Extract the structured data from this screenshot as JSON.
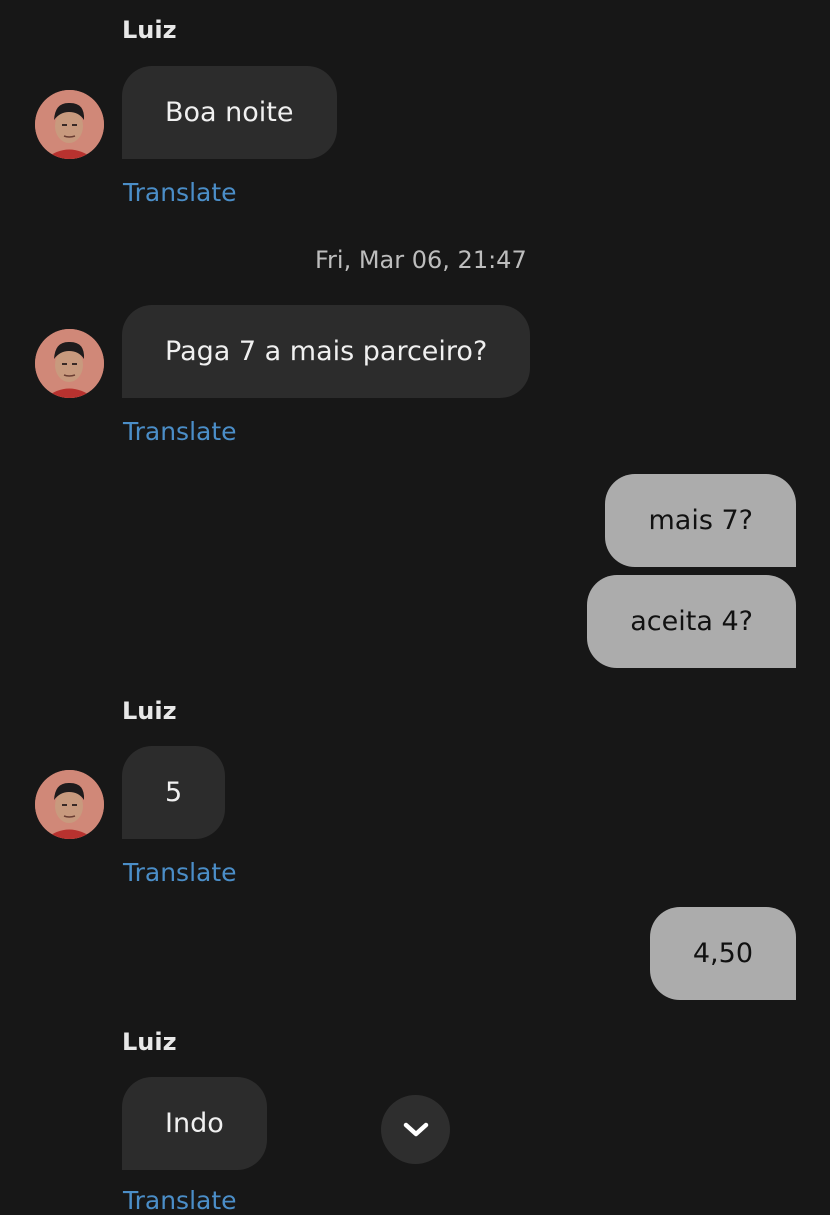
{
  "contact": {
    "name": "Luiz"
  },
  "messages": [
    {
      "direction": "in",
      "text": "Boa noite",
      "translate": "Translate"
    },
    {
      "direction": "in",
      "text": "Paga 7 a mais parceiro?",
      "translate": "Translate"
    },
    {
      "direction": "out",
      "text": "mais 7?"
    },
    {
      "direction": "out",
      "text": "aceita 4?"
    },
    {
      "direction": "in",
      "text": "5",
      "translate": "Translate"
    },
    {
      "direction": "out",
      "text": "4,50"
    },
    {
      "direction": "in",
      "text": "Indo",
      "translate": "Translate"
    }
  ],
  "timestamp": "Fri, Mar 06, 21:47",
  "scroll_button": {
    "icon": "chevron-down-icon"
  },
  "colors": {
    "background": "#171717",
    "incoming_bubble": "#2c2c2c",
    "outgoing_bubble": "#acacac",
    "link": "#4b8ec8"
  }
}
